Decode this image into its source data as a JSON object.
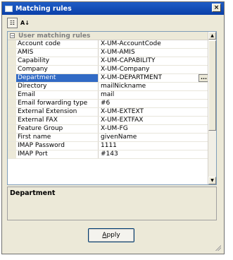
{
  "window": {
    "title": "Matching rules",
    "close_glyph": "×"
  },
  "toolbar": [
    {
      "name": "categorized-view-icon",
      "glyph": "☷"
    },
    {
      "name": "sort-alphabetical-icon",
      "glyph": "A↓"
    }
  ],
  "grid": {
    "category": {
      "label": "User matching rules",
      "expander": "−"
    },
    "rows": [
      {
        "name": "Account code",
        "value": "X-UM-AccountCode"
      },
      {
        "name": "AMIS",
        "value": "X-UM-AMIS"
      },
      {
        "name": "Capability",
        "value": "X-UM-CAPABILITY"
      },
      {
        "name": "Company",
        "value": "X-UM-Company"
      },
      {
        "name": "Department",
        "value": "X-UM-DEPARTMENT",
        "selected": true,
        "ellipsis": "..."
      },
      {
        "name": "Directory",
        "value": "mailNickname"
      },
      {
        "name": "Email",
        "value": "mail"
      },
      {
        "name": "Email forwarding type",
        "value": "#6"
      },
      {
        "name": "External Extension",
        "value": "X-UM-EXTEXT"
      },
      {
        "name": "External FAX",
        "value": "X-UM-EXTFAX"
      },
      {
        "name": "Feature Group",
        "value": "X-UM-FG"
      },
      {
        "name": "First name",
        "value": "givenName"
      },
      {
        "name": "IMAP Password",
        "value": "1111"
      },
      {
        "name": "IMAP Port",
        "value": "#143"
      }
    ],
    "scroll_up_glyph": "▲",
    "scroll_down_glyph": "▼"
  },
  "description": {
    "title": "Department"
  },
  "apply_button": {
    "accel": "A",
    "rest": "pply"
  }
}
